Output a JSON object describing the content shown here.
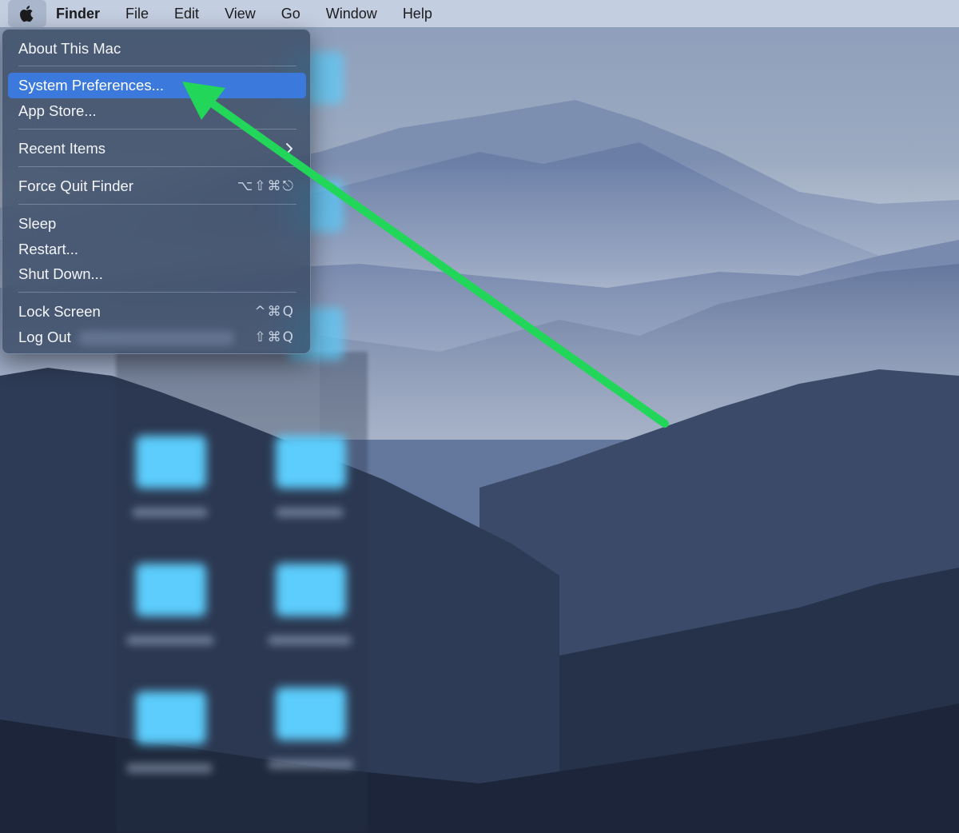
{
  "menubar": {
    "apple_icon": "apple-logo-icon",
    "app_name": "Finder",
    "items": [
      "File",
      "Edit",
      "View",
      "Go",
      "Window",
      "Help"
    ]
  },
  "apple_menu": {
    "about": "About This Mac",
    "system_preferences": "System Preferences...",
    "app_store": "App Store...",
    "recent_items": "Recent Items",
    "force_quit": "Force Quit Finder",
    "force_quit_shortcut": "⌥⇧⌘⎋",
    "sleep": "Sleep",
    "restart": "Restart...",
    "shut_down": "Shut Down...",
    "lock_screen": "Lock Screen",
    "lock_screen_shortcut": "^⌘Q",
    "log_out": "Log Out",
    "log_out_shortcut": "⇧⌘Q"
  },
  "colors": {
    "menubar_bg": "#c3cee0",
    "highlight": "#3b79dc",
    "annotation_arrow": "#22d65a",
    "folder": "#5ccdfc"
  }
}
